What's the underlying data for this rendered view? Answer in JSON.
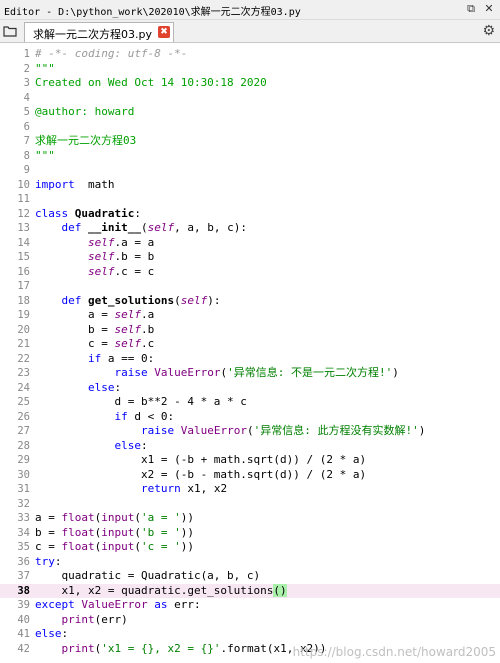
{
  "window": {
    "title": "Editor - D:\\python_work\\202010\\求解一元二次方程03.py",
    "undock_glyph": "⧉",
    "close_glyph": "✕"
  },
  "tabs": [
    {
      "label": "求解一元二次方程03.py",
      "close_glyph": "✖"
    }
  ],
  "options_glyph": "⚙",
  "current_line": 38,
  "watermark": "https://blog.csdn.net/howard2005",
  "code_lines": [
    {
      "n": "1",
      "t": [
        [
          "c",
          "# -*- coding: utf-8 -*-"
        ]
      ]
    },
    {
      "n": "2",
      "t": [
        [
          "doc",
          "\"\"\""
        ]
      ]
    },
    {
      "n": "3",
      "t": [
        [
          "doc",
          "Created on Wed Oct 14 10:30:18 2020"
        ]
      ]
    },
    {
      "n": "4",
      "t": []
    },
    {
      "n": "5",
      "t": [
        [
          "doc",
          "@author: howard"
        ]
      ]
    },
    {
      "n": "6",
      "t": []
    },
    {
      "n": "7",
      "t": [
        [
          "doc",
          "求解一元二次方程03"
        ]
      ]
    },
    {
      "n": "8",
      "t": [
        [
          "doc",
          "\"\"\""
        ]
      ]
    },
    {
      "n": "9",
      "t": []
    },
    {
      "n": "10",
      "t": [
        [
          "k",
          "import"
        ],
        [
          "",
          "  math"
        ]
      ]
    },
    {
      "n": "11",
      "t": []
    },
    {
      "n": "12",
      "t": [
        [
          "k",
          "class"
        ],
        [
          "",
          " "
        ],
        [
          "cls",
          "Quadratic"
        ],
        [
          "",
          ":"
        ]
      ]
    },
    {
      "n": "13",
      "t": [
        [
          "",
          "    "
        ],
        [
          "k",
          "def"
        ],
        [
          "",
          " "
        ],
        [
          "fn",
          "__init__"
        ],
        [
          "",
          "("
        ],
        [
          "sf",
          "self"
        ],
        [
          "",
          ", a, b, c):"
        ]
      ]
    },
    {
      "n": "14",
      "t": [
        [
          "",
          "        "
        ],
        [
          "sf",
          "self"
        ],
        [
          "",
          ".a = a"
        ]
      ]
    },
    {
      "n": "15",
      "t": [
        [
          "",
          "        "
        ],
        [
          "sf",
          "self"
        ],
        [
          "",
          ".b = b"
        ]
      ]
    },
    {
      "n": "16",
      "t": [
        [
          "",
          "        "
        ],
        [
          "sf",
          "self"
        ],
        [
          "",
          ".c = c"
        ]
      ]
    },
    {
      "n": "17",
      "t": []
    },
    {
      "n": "18",
      "t": [
        [
          "",
          "    "
        ],
        [
          "k",
          "def"
        ],
        [
          "",
          " "
        ],
        [
          "fn",
          "get_solutions"
        ],
        [
          "",
          "("
        ],
        [
          "sf",
          "self"
        ],
        [
          "",
          "):"
        ]
      ]
    },
    {
      "n": "19",
      "t": [
        [
          "",
          "        a = "
        ],
        [
          "sf",
          "self"
        ],
        [
          "",
          ".a"
        ]
      ]
    },
    {
      "n": "20",
      "t": [
        [
          "",
          "        b = "
        ],
        [
          "sf",
          "self"
        ],
        [
          "",
          ".b"
        ]
      ]
    },
    {
      "n": "21",
      "t": [
        [
          "",
          "        c = "
        ],
        [
          "sf",
          "self"
        ],
        [
          "",
          ".c"
        ]
      ]
    },
    {
      "n": "22",
      "t": [
        [
          "",
          "        "
        ],
        [
          "k",
          "if"
        ],
        [
          "",
          " a == 0:"
        ]
      ]
    },
    {
      "n": "23",
      "t": [
        [
          "",
          "            "
        ],
        [
          "k",
          "raise"
        ],
        [
          "",
          " "
        ],
        [
          "exc",
          "ValueError"
        ],
        [
          "",
          "("
        ],
        [
          "s",
          "'异常信息: 不是一元二次方程!'"
        ],
        [
          "",
          ")"
        ]
      ]
    },
    {
      "n": "24",
      "t": [
        [
          "",
          "        "
        ],
        [
          "k",
          "else"
        ],
        [
          "",
          ":"
        ]
      ]
    },
    {
      "n": "25",
      "t": [
        [
          "",
          "            d = b**2 - 4 * a * c"
        ]
      ]
    },
    {
      "n": "26",
      "t": [
        [
          "",
          "            "
        ],
        [
          "k",
          "if"
        ],
        [
          "",
          " d < 0:"
        ]
      ]
    },
    {
      "n": "27",
      "t": [
        [
          "",
          "                "
        ],
        [
          "k",
          "raise"
        ],
        [
          "",
          " "
        ],
        [
          "exc",
          "ValueError"
        ],
        [
          "",
          "("
        ],
        [
          "s",
          "'异常信息: 此方程没有实数解!'"
        ],
        [
          "",
          ")"
        ]
      ]
    },
    {
      "n": "28",
      "t": [
        [
          "",
          "            "
        ],
        [
          "k",
          "else"
        ],
        [
          "",
          ":"
        ]
      ]
    },
    {
      "n": "29",
      "t": [
        [
          "",
          "                x1 = (-b + math.sqrt(d)) / (2 * a)"
        ]
      ]
    },
    {
      "n": "30",
      "t": [
        [
          "",
          "                x2 = (-b - math.sqrt(d)) / (2 * a)"
        ]
      ]
    },
    {
      "n": "31",
      "t": [
        [
          "",
          "                "
        ],
        [
          "k",
          "return"
        ],
        [
          "",
          " x1, x2"
        ]
      ]
    },
    {
      "n": "32",
      "t": []
    },
    {
      "n": "33",
      "t": [
        [
          "",
          "a = "
        ],
        [
          "b",
          "float"
        ],
        [
          "",
          "("
        ],
        [
          "b",
          "input"
        ],
        [
          "",
          "("
        ],
        [
          "s",
          "'a = '"
        ],
        [
          "",
          "))"
        ]
      ]
    },
    {
      "n": "34",
      "t": [
        [
          "",
          "b = "
        ],
        [
          "b",
          "float"
        ],
        [
          "",
          "("
        ],
        [
          "b",
          "input"
        ],
        [
          "",
          "("
        ],
        [
          "s",
          "'b = '"
        ],
        [
          "",
          "))"
        ]
      ]
    },
    {
      "n": "35",
      "t": [
        [
          "",
          "c = "
        ],
        [
          "b",
          "float"
        ],
        [
          "",
          "("
        ],
        [
          "b",
          "input"
        ],
        [
          "",
          "("
        ],
        [
          "s",
          "'c = '"
        ],
        [
          "",
          "))"
        ]
      ]
    },
    {
      "n": "36",
      "t": [
        [
          "k",
          "try"
        ],
        [
          "",
          ":"
        ]
      ]
    },
    {
      "n": "37",
      "t": [
        [
          "",
          "    quadratic = Quadratic(a, b, c)"
        ]
      ]
    },
    {
      "n": "38",
      "t": [
        [
          "",
          "    x1, x2 = quadratic.get_solutions"
        ],
        [
          "match",
          "()"
        ]
      ]
    },
    {
      "n": "39",
      "t": [
        [
          "k",
          "except"
        ],
        [
          "",
          " "
        ],
        [
          "exc",
          "ValueError"
        ],
        [
          "",
          " "
        ],
        [
          "k",
          "as"
        ],
        [
          "",
          " err:"
        ]
      ]
    },
    {
      "n": "40",
      "t": [
        [
          "",
          "    "
        ],
        [
          "b",
          "print"
        ],
        [
          "",
          "(err)"
        ]
      ]
    },
    {
      "n": "41",
      "t": [
        [
          "k",
          "else"
        ],
        [
          "",
          ":"
        ]
      ]
    },
    {
      "n": "42",
      "t": [
        [
          "",
          "    "
        ],
        [
          "b",
          "print"
        ],
        [
          "",
          "("
        ],
        [
          "s",
          "'x1 = {}, x2 = {}'"
        ],
        [
          "",
          ".format(x1, x2))"
        ]
      ]
    }
  ]
}
